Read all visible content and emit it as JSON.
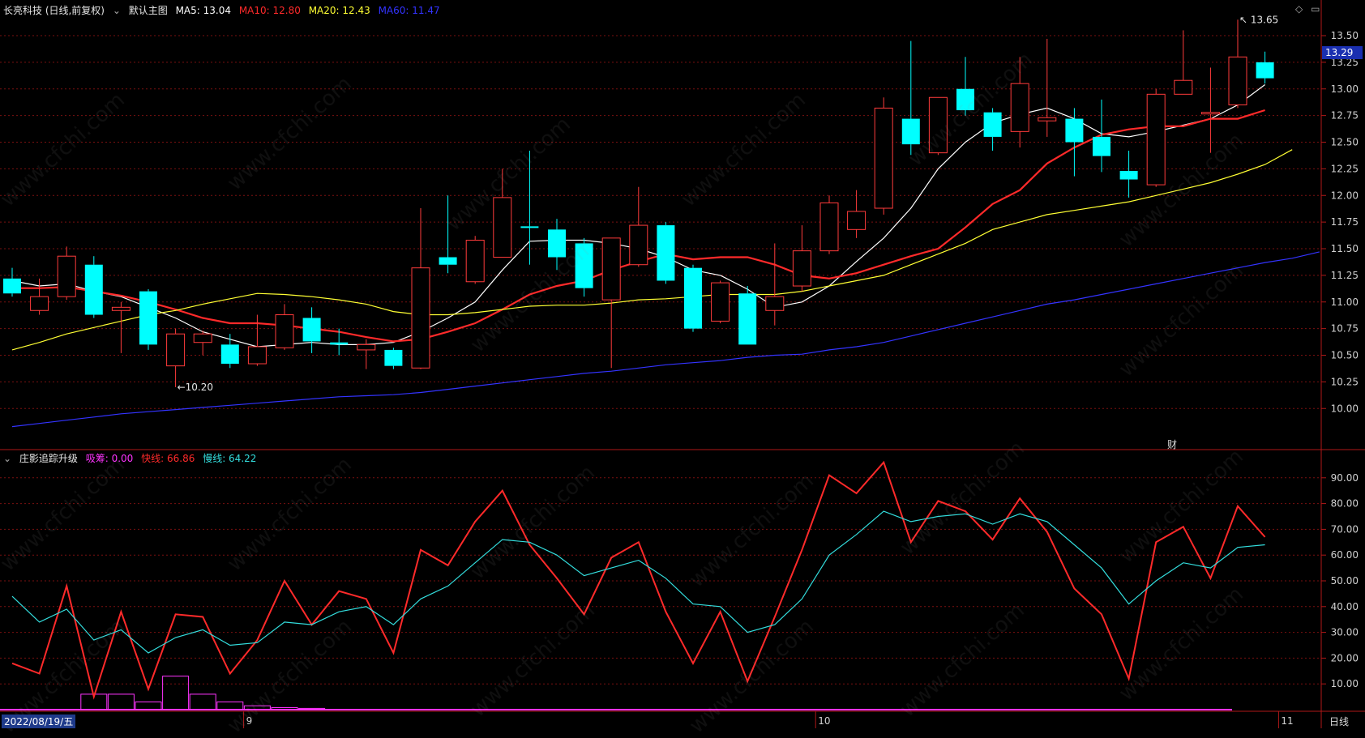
{
  "header": {
    "title": "长亮科技 (日线,前复权)",
    "main_label": "默认主图",
    "ma_items": [
      {
        "label": "MA5: 13.04",
        "color": "#ffffff"
      },
      {
        "label": "MA10: 12.80",
        "color": "#ff2a2a"
      },
      {
        "label": "MA20: 12.43",
        "color": "#ffff33"
      },
      {
        "label": "MA60: 11.47",
        "color": "#3333ff"
      }
    ]
  },
  "indicator": {
    "title": "庄影追踪升级",
    "items": [
      {
        "label": "吸筹: 0.00",
        "color": "#ff33ff"
      },
      {
        "label": "快线: 66.86",
        "color": "#ff2a2a"
      },
      {
        "label": "慢线: 64.22",
        "color": "#33dddd"
      }
    ]
  },
  "price_axis": {
    "ticks": [
      "13.50",
      "13.25",
      "13.00",
      "12.75",
      "12.50",
      "12.25",
      "12.00",
      "11.75",
      "11.50",
      "11.25",
      "11.00",
      "10.75",
      "10.50",
      "10.25",
      "10.00"
    ],
    "current_price": "13.29"
  },
  "indicator_axis": {
    "ticks": [
      "90.00",
      "80.00",
      "70.00",
      "60.00",
      "50.00",
      "40.00",
      "30.00",
      "20.00",
      "10.00"
    ]
  },
  "date_axis": {
    "start": "2022/08/19/五",
    "month_marks": [
      {
        "label": "9",
        "index": 9
      },
      {
        "label": "10",
        "index": 30
      },
      {
        "label": "11",
        "index": 47
      }
    ],
    "period_button": "日线"
  },
  "annotations": {
    "low_label": "10.20",
    "high_label": "13.65",
    "finance_mark": "财"
  },
  "watermark": "www.cfchi.com",
  "chart_data": [
    {
      "type": "candlestick",
      "ylim": [
        9.85,
        13.6
      ],
      "colors": {
        "up": "#ff3b3b",
        "down": "#00ffff"
      },
      "candles": [
        {
          "o": 11.22,
          "h": 11.32,
          "l": 11.05,
          "c": 11.08
        },
        {
          "o": 10.92,
          "h": 11.22,
          "l": 10.88,
          "c": 11.05
        },
        {
          "o": 11.05,
          "h": 11.52,
          "l": 11.02,
          "c": 11.43
        },
        {
          "o": 11.35,
          "h": 11.43,
          "l": 10.85,
          "c": 10.88
        },
        {
          "o": 10.92,
          "h": 11.0,
          "l": 10.52,
          "c": 10.95
        },
        {
          "o": 11.1,
          "h": 11.12,
          "l": 10.55,
          "c": 10.6
        },
        {
          "o": 10.4,
          "h": 10.75,
          "l": 10.2,
          "c": 10.7
        },
        {
          "o": 10.62,
          "h": 10.73,
          "l": 10.5,
          "c": 10.7
        },
        {
          "o": 10.6,
          "h": 10.7,
          "l": 10.38,
          "c": 10.42
        },
        {
          "o": 10.42,
          "h": 10.88,
          "l": 10.4,
          "c": 10.58
        },
        {
          "o": 10.57,
          "h": 10.98,
          "l": 10.55,
          "c": 10.88
        },
        {
          "o": 10.85,
          "h": 10.95,
          "l": 10.52,
          "c": 10.63
        },
        {
          "o": 10.62,
          "h": 10.75,
          "l": 10.5,
          "c": 10.6
        },
        {
          "o": 10.55,
          "h": 10.65,
          "l": 10.37,
          "c": 10.6
        },
        {
          "o": 10.55,
          "h": 10.57,
          "l": 10.37,
          "c": 10.4
        },
        {
          "o": 10.38,
          "h": 11.88,
          "l": 10.37,
          "c": 11.32
        },
        {
          "o": 11.42,
          "h": 12.0,
          "l": 11.27,
          "c": 11.35
        },
        {
          "o": 11.19,
          "h": 11.62,
          "l": 11.17,
          "c": 11.58
        },
        {
          "o": 11.42,
          "h": 12.25,
          "l": 11.42,
          "c": 11.98
        },
        {
          "o": 11.71,
          "h": 12.42,
          "l": 11.35,
          "c": 11.7
        },
        {
          "o": 11.68,
          "h": 11.78,
          "l": 11.3,
          "c": 11.42
        },
        {
          "o": 11.55,
          "h": 11.6,
          "l": 11.05,
          "c": 11.13
        },
        {
          "o": 11.02,
          "h": 11.6,
          "l": 10.38,
          "c": 11.6
        },
        {
          "o": 11.35,
          "h": 12.08,
          "l": 11.33,
          "c": 11.72
        },
        {
          "o": 11.72,
          "h": 11.75,
          "l": 11.17,
          "c": 11.2
        },
        {
          "o": 11.32,
          "h": 11.35,
          "l": 10.72,
          "c": 10.75
        },
        {
          "o": 10.82,
          "h": 11.2,
          "l": 10.8,
          "c": 11.18
        },
        {
          "o": 11.08,
          "h": 11.15,
          "l": 10.6,
          "c": 10.6
        },
        {
          "o": 10.92,
          "h": 11.55,
          "l": 10.78,
          "c": 11.05
        },
        {
          "o": 11.15,
          "h": 11.72,
          "l": 11.1,
          "c": 11.48
        },
        {
          "o": 11.48,
          "h": 12.0,
          "l": 11.45,
          "c": 11.93
        },
        {
          "o": 11.68,
          "h": 12.05,
          "l": 11.6,
          "c": 11.85
        },
        {
          "o": 11.88,
          "h": 12.92,
          "l": 11.82,
          "c": 12.82
        },
        {
          "o": 12.72,
          "h": 13.45,
          "l": 12.38,
          "c": 12.48
        },
        {
          "o": 12.4,
          "h": 12.92,
          "l": 12.38,
          "c": 12.92
        },
        {
          "o": 13.0,
          "h": 13.3,
          "l": 12.75,
          "c": 12.8
        },
        {
          "o": 12.78,
          "h": 12.82,
          "l": 12.42,
          "c": 12.55
        },
        {
          "o": 12.6,
          "h": 13.3,
          "l": 12.45,
          "c": 13.05
        },
        {
          "o": 12.7,
          "h": 13.47,
          "l": 12.55,
          "c": 12.73
        },
        {
          "o": 12.72,
          "h": 12.82,
          "l": 12.18,
          "c": 12.5
        },
        {
          "o": 12.55,
          "h": 12.9,
          "l": 12.22,
          "c": 12.37
        },
        {
          "o": 12.23,
          "h": 12.42,
          "l": 11.98,
          "c": 12.15
        },
        {
          "o": 12.1,
          "h": 13.0,
          "l": 12.08,
          "c": 12.95
        },
        {
          "o": 12.95,
          "h": 13.55,
          "l": 12.95,
          "c": 13.08
        },
        {
          "o": 12.78,
          "h": 13.2,
          "l": 12.4,
          "c": 12.78
        },
        {
          "o": 12.85,
          "h": 13.65,
          "l": 12.82,
          "c": 13.3
        },
        {
          "o": 13.25,
          "h": 13.35,
          "l": 13.05,
          "c": 13.1
        }
      ],
      "ma_lines": [
        {
          "name": "MA5",
          "color": "#ffffff",
          "values": [
            11.2,
            11.15,
            11.17,
            11.1,
            11.05,
            10.95,
            10.85,
            10.72,
            10.65,
            10.58,
            10.6,
            10.62,
            10.6,
            10.6,
            10.62,
            10.72,
            10.85,
            11.0,
            11.3,
            11.57,
            11.58,
            11.58,
            11.55,
            11.5,
            11.42,
            11.3,
            11.25,
            11.12,
            10.95,
            11.0,
            11.15,
            11.38,
            11.6,
            11.88,
            12.25,
            12.5,
            12.68,
            12.76,
            12.82,
            12.72,
            12.58,
            12.55,
            12.6,
            12.66,
            12.72,
            12.85,
            13.04
          ]
        },
        {
          "name": "MA10",
          "color": "#ff2a2a",
          "values": [
            11.13,
            11.13,
            11.14,
            11.1,
            11.06,
            11.0,
            10.93,
            10.85,
            10.8,
            10.8,
            10.78,
            10.75,
            10.72,
            10.67,
            10.63,
            10.65,
            10.72,
            10.8,
            10.93,
            11.07,
            11.15,
            11.2,
            11.3,
            11.38,
            11.45,
            11.4,
            11.42,
            11.42,
            11.35,
            11.25,
            11.22,
            11.27,
            11.35,
            11.43,
            11.5,
            11.7,
            11.92,
            12.05,
            12.3,
            12.45,
            12.57,
            12.62,
            12.65,
            12.65,
            12.72,
            12.72,
            12.8
          ]
        },
        {
          "name": "MA20",
          "color": "#ffff33",
          "values": [
            10.55,
            10.62,
            10.7,
            10.76,
            10.82,
            10.88,
            10.92,
            10.98,
            11.03,
            11.08,
            11.07,
            11.05,
            11.02,
            10.98,
            10.91,
            10.88,
            10.88,
            10.9,
            10.93,
            10.96,
            10.97,
            10.97,
            10.99,
            11.02,
            11.03,
            11.05,
            11.07,
            11.07,
            11.07,
            11.1,
            11.15,
            11.2,
            11.25,
            11.35,
            11.45,
            11.55,
            11.68,
            11.75,
            11.82,
            11.86,
            11.9,
            11.94,
            12.0,
            12.06,
            12.12,
            12.2,
            12.29,
            12.43
          ]
        },
        {
          "name": "MA60",
          "color": "#3333ff",
          "values": [
            9.83,
            9.86,
            9.89,
            9.92,
            9.95,
            9.97,
            9.99,
            10.01,
            10.03,
            10.05,
            10.07,
            10.09,
            10.11,
            10.12,
            10.13,
            10.15,
            10.18,
            10.21,
            10.24,
            10.27,
            10.3,
            10.33,
            10.35,
            10.38,
            10.41,
            10.43,
            10.45,
            10.48,
            10.5,
            10.51,
            10.55,
            10.58,
            10.62,
            10.68,
            10.74,
            10.8,
            10.86,
            10.92,
            10.98,
            11.02,
            11.07,
            11.12,
            11.17,
            11.22,
            11.27,
            11.32,
            11.37,
            11.41,
            11.47
          ]
        }
      ]
    },
    {
      "type": "line",
      "ylim": [
        0,
        100
      ],
      "series": [
        {
          "name": "快线",
          "color": "#ff2a2a",
          "values": [
            18,
            14,
            48,
            5,
            38,
            8,
            37,
            36,
            14,
            27,
            50,
            33,
            46,
            43,
            22,
            62,
            56,
            73,
            85,
            64,
            51,
            37,
            59,
            65,
            38,
            18,
            38,
            11,
            36,
            62,
            91,
            84,
            96,
            65,
            81,
            77,
            66,
            82,
            69,
            47,
            37,
            12,
            65,
            71,
            51,
            79,
            67
          ]
        },
        {
          "name": "慢线",
          "color": "#33dddd",
          "values": [
            44,
            34,
            39,
            27,
            31,
            22,
            28,
            31,
            25,
            26,
            34,
            33,
            38,
            40,
            33,
            43,
            48,
            57,
            66,
            65,
            60,
            52,
            55,
            58,
            51,
            41,
            40,
            30,
            33,
            43,
            60,
            68,
            77,
            73,
            75,
            76,
            72,
            76,
            73,
            64,
            55,
            41,
            50,
            57,
            55,
            63,
            64
          ]
        }
      ],
      "bars": {
        "name": "吸筹",
        "color": "#ff33ff",
        "values": [
          0,
          0,
          0,
          6,
          6,
          3,
          13,
          6,
          3,
          1.5,
          0.8,
          0.5,
          0,
          0,
          0,
          0,
          0,
          0,
          0,
          0,
          0,
          0,
          0,
          0,
          0,
          0,
          0,
          0,
          0,
          0,
          0,
          0,
          0,
          0,
          0,
          0,
          0,
          0,
          0,
          0,
          0,
          0,
          0,
          0,
          0,
          0,
          0
        ]
      }
    }
  ]
}
